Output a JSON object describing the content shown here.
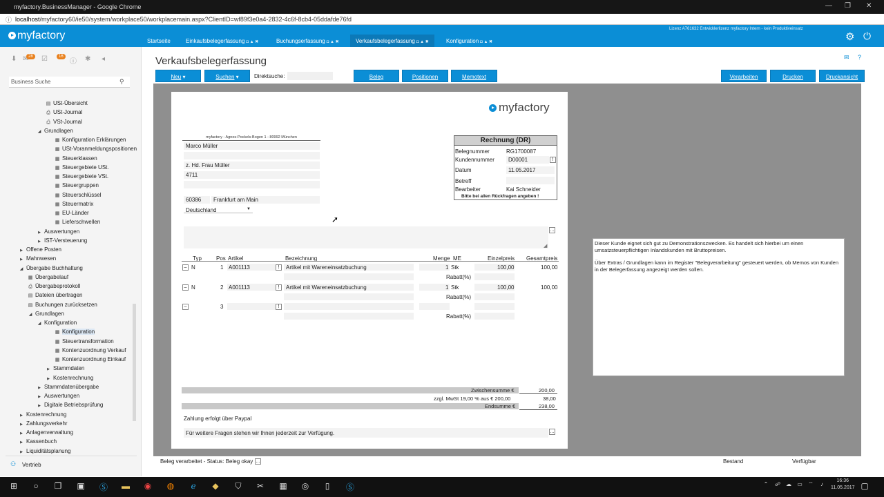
{
  "browser": {
    "title": "myfactory.BusinessManager - Google Chrome",
    "url_host": "localhost",
    "url_path": "/myfactory60/ie50/system/workplace50/workplacemain.aspx?ClientID=wf89f3e0a4-2832-4c6f-8cb4-05ddafde76fd"
  },
  "app": {
    "logo": "myfactory",
    "license": "Lizenz A761632 Entwicklerlizenz myfactory Intern - kein Produktiveinsatz",
    "tabs": [
      "Startseite",
      "Einkaufsbelegerfassung",
      "Buchungserfassung",
      "Verkaufsbelegerfassung",
      "Konfiguration"
    ],
    "tab_icons": "◘ ▲ ✖"
  },
  "sidebar": {
    "badges": [
      "28",
      "16"
    ],
    "search_placeholder": "Business Suche",
    "tree": [
      {
        "label": "USt-Übersicht",
        "icon": "doc"
      },
      {
        "label": "USt-Journal",
        "icon": "print"
      },
      {
        "label": "VSt-Journal",
        "icon": "print"
      },
      {
        "label": "Grundlagen",
        "icon": "open"
      },
      {
        "label": "Konfiguration Erklärungen",
        "icon": "table"
      },
      {
        "label": "USt-Voranmeldungspositionen",
        "icon": "table"
      },
      {
        "label": "Steuerklassen",
        "icon": "table"
      },
      {
        "label": "Steuergebiete USt.",
        "icon": "table"
      },
      {
        "label": "Steuergebiete VSt.",
        "icon": "table"
      },
      {
        "label": "Steuergruppen",
        "icon": "table"
      },
      {
        "label": "Steuerschlüssel",
        "icon": "table"
      },
      {
        "label": "Steuermatrix",
        "icon": "table"
      },
      {
        "label": "EU-Länder",
        "icon": "table"
      },
      {
        "label": "Lieferschwellen",
        "icon": "table"
      },
      {
        "label": "Auswertungen",
        "icon": "closed"
      },
      {
        "label": "IST-Versteuerung",
        "icon": "closed"
      },
      {
        "label": "Offene Posten",
        "icon": "closed"
      },
      {
        "label": "Mahnwesen",
        "icon": "closed"
      },
      {
        "label": "Übergabe Buchhaltung",
        "icon": "open"
      },
      {
        "label": "Übergabelauf",
        "icon": "table"
      },
      {
        "label": "Übergabeprotokoll",
        "icon": "print"
      },
      {
        "label": "Dateien übertragen",
        "icon": "doc"
      },
      {
        "label": "Buchungen zurücksetzen",
        "icon": "doc"
      },
      {
        "label": "Grundlagen",
        "icon": "open"
      },
      {
        "label": "Konfiguration",
        "icon": "open"
      },
      {
        "label": "Konfiguration",
        "icon": "table"
      },
      {
        "label": "Steuertransformation",
        "icon": "table"
      },
      {
        "label": "Kontenzuordnung Verkauf",
        "icon": "table"
      },
      {
        "label": "Kontenzuordnung Einkauf",
        "icon": "table"
      },
      {
        "label": "Stammdaten",
        "icon": "closed"
      },
      {
        "label": "Kostenrechnung",
        "icon": "closed"
      },
      {
        "label": "Stammdatenübergabe",
        "icon": "closed"
      },
      {
        "label": "Auswertungen",
        "icon": "closed"
      },
      {
        "label": "Digitale Betriebsprüfung",
        "icon": "closed"
      },
      {
        "label": "Kostenrechnung",
        "icon": "closed"
      },
      {
        "label": "Zahlungsverkehr",
        "icon": "closed"
      },
      {
        "label": "Anlagenverwaltung",
        "icon": "closed"
      },
      {
        "label": "Kassenbuch",
        "icon": "closed"
      },
      {
        "label": "Liquiditätsplanung",
        "icon": "closed"
      }
    ],
    "footer": "Vertrieb"
  },
  "page": {
    "title": "Verkaufsbelegerfassung",
    "buttons": {
      "neu": "Neu",
      "suchen": "Suchen",
      "direktsuche": "Direktsuche:",
      "beleg": "Beleg",
      "positionen": "Positionen",
      "memotext": "Memotext",
      "verarbeiten": "Verarbeiten",
      "drucken": "Drucken",
      "druckansicht": "Druckansicht"
    }
  },
  "document": {
    "logo": "myfactory",
    "sender": "myfactory - Agnes-Pockels-Bogen 1 - 80992 München",
    "address": {
      "name": "Marco Müller",
      "contact": "z. Hd. Frau Müller",
      "number": "4711",
      "zip": "60386",
      "city": "Frankfurt am Main",
      "country": "Deutschland"
    },
    "rbox": {
      "title": "Rechnung (DR)",
      "belegnummer_l": "Belegnummer",
      "belegnummer": "RG1700087",
      "kunden_l": "Kundennummer",
      "kunden": "D00001",
      "datum_l": "Datum",
      "datum": "11.05.2017",
      "betreff_l": "Betreff",
      "bearbeiter_l": "Bearbeiter",
      "bearbeiter": "Kai Schneider",
      "hinweis": "Bitte bei allen Rückfragen angeben !"
    },
    "columns": {
      "typ": "Typ",
      "pos": "Pos",
      "artikel": "Artikel",
      "bezeichnung": "Bezeichnung",
      "menge": "Menge",
      "me": "ME",
      "einzelpreis": "Einzelpreis",
      "gesamtpreis": "Gesamtpreis"
    },
    "positions": [
      {
        "typ": "N",
        "pos": "1",
        "artikel": "A001113",
        "bezeichnung": "Artikel mit Wareneinsatzbuchung",
        "menge": "1",
        "me": "Stk",
        "einzelpreis": "100,00",
        "gesamtpreis": "100,00",
        "rabatt": "Rabatt(%)"
      },
      {
        "typ": "N",
        "pos": "2",
        "artikel": "A001113",
        "bezeichnung": "Artikel mit Wareneinsatzbuchung",
        "menge": "1",
        "me": "Stk",
        "einzelpreis": "100,00",
        "gesamtpreis": "100,00",
        "rabatt": "Rabatt(%)"
      },
      {
        "typ": "",
        "pos": "3",
        "artikel": "",
        "bezeichnung": "",
        "menge": "",
        "me": "",
        "einzelpreis": "",
        "gesamtpreis": "",
        "rabatt": "Rabatt(%)"
      }
    ],
    "totals": {
      "zwischen_l": "Zwischensumme €",
      "zwischen": "200,00",
      "mwst_l": "zzgl. MwSt 19,00 % aus € 200,00",
      "mwst": "38,00",
      "end_l": "Endsumme €",
      "end": "238,00"
    },
    "zahlung": "Zahlung erfolgt über Paypal",
    "footer_text": "Für weitere Fragen stehen wir Ihnen jederzeit zur Verfügung."
  },
  "note": {
    "p1": "Dieser Kunde eignet sich gut zu Demonstrationszwecken. Es handelt sich hierbei um einen umsatzsteuerpflichtigen Inlandskunden mit Bruttopreisen.",
    "p2": "Über Extras / Grundlagen kann im Register \"Belegverarbeitung\" gesteuert werden, ob Memos von Kunden in der Belegerfassung angezeigt werden sollen."
  },
  "status": {
    "text": "Beleg verarbeitet - Status: Beleg okay",
    "bestand": "Bestand",
    "verfuegbar": "Verfügbar"
  },
  "taskbar": {
    "time": "16:36",
    "date": "11.05.2017"
  }
}
